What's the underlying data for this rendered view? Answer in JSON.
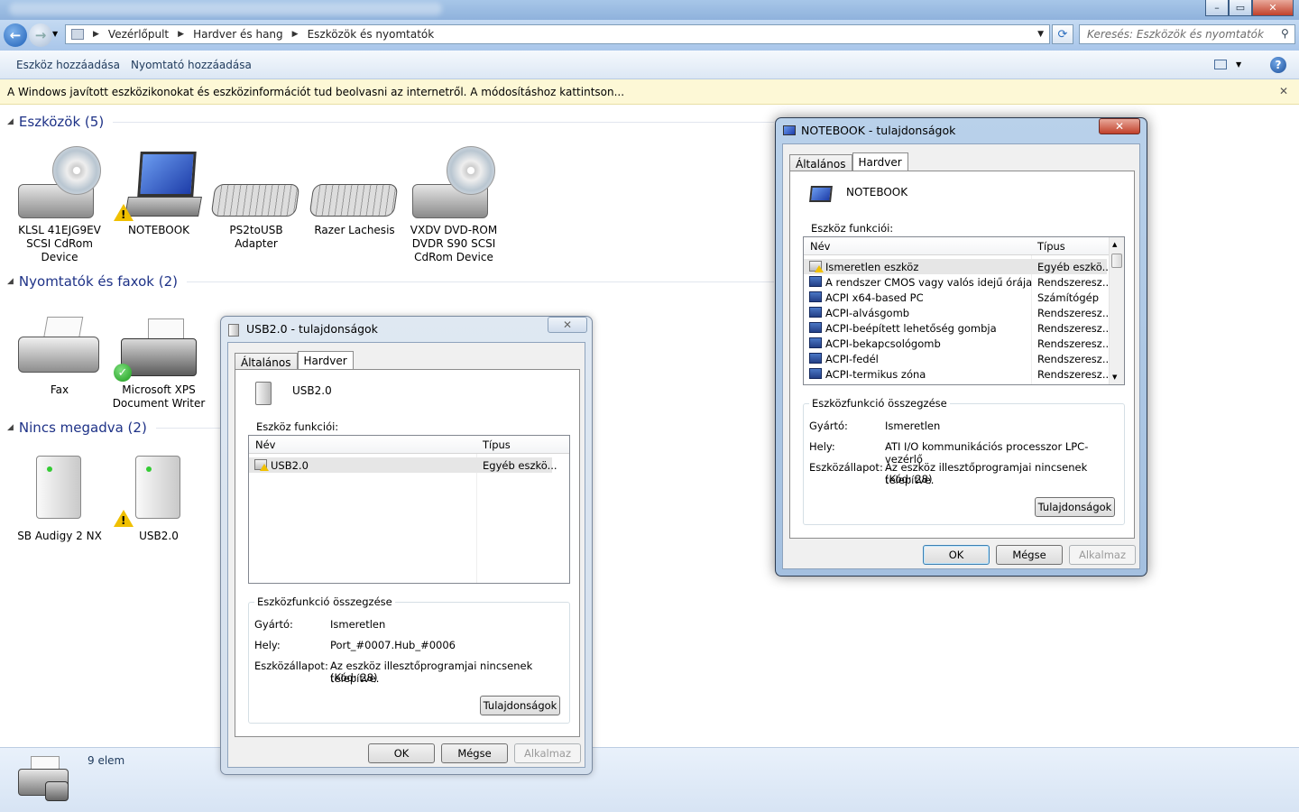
{
  "window": {
    "title_blurred": true,
    "min": "–",
    "max": "▭",
    "close": "✕"
  },
  "address": {
    "seg1": "Vezérlőpult",
    "seg2": "Hardver és hang",
    "seg3": "Eszközök és nyomtatók"
  },
  "search": {
    "placeholder": "Keresés: Eszközök és nyomtatók"
  },
  "toolbar": {
    "add_device": "Eszköz hozzáadása",
    "add_printer": "Nyomtató hozzáadása"
  },
  "infobar": {
    "text": "A Windows javított eszközikonokat és eszközinformációt tud beolvasni az internetről. A módosításhoz kattintson..."
  },
  "groups": {
    "devices": {
      "label": "Eszközök (5)",
      "items": [
        {
          "l1": "KLSL 41EJG9EV",
          "l2": "SCSI CdRom",
          "l3": "Device"
        },
        {
          "l1": "NOTEBOOK",
          "l2": "",
          "l3": ""
        },
        {
          "l1": "PS2toUSB",
          "l2": "Adapter",
          "l3": ""
        },
        {
          "l1": "Razer Lachesis",
          "l2": "",
          "l3": ""
        },
        {
          "l1": "VXDV DVD-ROM",
          "l2": "DVDR S90 SCSI",
          "l3": "CdRom Device"
        }
      ]
    },
    "printers": {
      "label": "Nyomtatók és faxok (2)",
      "items": [
        {
          "l1": "Fax",
          "l2": ""
        },
        {
          "l1": "Microsoft XPS",
          "l2": "Document Writer"
        }
      ]
    },
    "unspecified": {
      "label": "Nincs megadva (2)",
      "items": [
        {
          "l1": "SB Audigy 2 NX"
        },
        {
          "l1": "USB2.0"
        }
      ]
    }
  },
  "status": {
    "count": "9 elem"
  },
  "usb_dialog": {
    "title": "USB2.0 - tulajdonságok",
    "tab_general": "Általános",
    "tab_hardware": "Hardver",
    "device_name": "USB2.0",
    "functions_label": "Eszköz funkciói:",
    "col_name": "Név",
    "col_type": "Típus",
    "rows": [
      {
        "name": "USB2.0",
        "type": "Egyéb eszkö..."
      }
    ],
    "summary_title": "Eszközfunkció összegzése",
    "mfr_label": "Gyártó:",
    "mfr": "Ismeretlen",
    "loc_label": "Hely:",
    "loc": "Port_#0007.Hub_#0006",
    "state_label": "Eszközállapot:",
    "state1": "Az eszköz illesztőprogramjai nincsenek telepítve.",
    "state2": "(Kód: 28)",
    "props_btn": "Tulajdonságok",
    "ok": "OK",
    "cancel": "Mégse",
    "apply": "Alkalmaz"
  },
  "nb_dialog": {
    "title": "NOTEBOOK - tulajdonságok",
    "tab_general": "Általános",
    "tab_hardware": "Hardver",
    "device_name": "NOTEBOOK",
    "functions_label": "Eszköz funkciói:",
    "col_name": "Név",
    "col_type": "Típus",
    "rows": [
      {
        "name": "Ismeretlen eszköz",
        "type": "Egyéb eszkö..."
      },
      {
        "name": "A rendszer CMOS vagy valós idejű órája",
        "type": "Rendszeresz..."
      },
      {
        "name": "ACPI x64-based PC",
        "type": "Számítógép"
      },
      {
        "name": "ACPI-alvásgomb",
        "type": "Rendszeresz..."
      },
      {
        "name": "ACPI-beépített lehetőség gombja",
        "type": "Rendszeresz..."
      },
      {
        "name": "ACPI-bekapcsológomb",
        "type": "Rendszeresz..."
      },
      {
        "name": "ACPI-fedél",
        "type": "Rendszeresz..."
      },
      {
        "name": "ACPI-termikus zóna",
        "type": "Rendszeresz..."
      }
    ],
    "summary_title": "Eszközfunkció összegzése",
    "mfr_label": "Gyártó:",
    "mfr": "Ismeretlen",
    "loc_label": "Hely:",
    "loc": "ATI I/O kommunikációs processzor LPC-vezérlő",
    "state_label": "Eszközállapot:",
    "state1": "Az eszköz illesztőprogramjai nincsenek telepítve.",
    "state2": "(Kód: 28)",
    "props_btn": "Tulajdonságok",
    "ok": "OK",
    "cancel": "Mégse",
    "apply": "Alkalmaz"
  }
}
